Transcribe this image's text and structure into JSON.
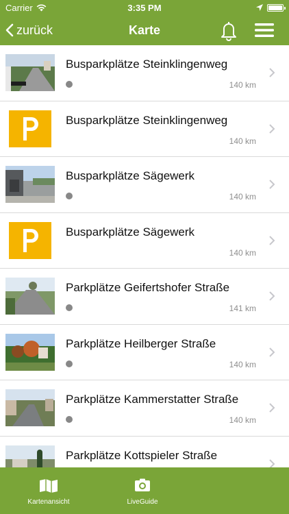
{
  "statusbar": {
    "carrier": "Carrier",
    "time": "3:35 PM"
  },
  "navbar": {
    "back_label": "zurück",
    "title": "Karte"
  },
  "list": {
    "items": [
      {
        "title": "Busparkplätze Steinklingenweg",
        "distance": "140 km",
        "thumb": "photo-road"
      },
      {
        "title": "Busparkplätze Steinklingenweg",
        "distance": "140 km",
        "thumb": "parking-sign"
      },
      {
        "title": "Busparkplätze Sägewerk",
        "distance": "140 km",
        "thumb": "photo-building"
      },
      {
        "title": "Busparkplätze Sägewerk",
        "distance": "140 km",
        "thumb": "parking-sign"
      },
      {
        "title": "Parkplätze Geifertshofer Straße",
        "distance": "141 km",
        "thumb": "photo-road"
      },
      {
        "title": "Parkplätze Heilberger Straße",
        "distance": "140 km",
        "thumb": "photo-autumn"
      },
      {
        "title": "Parkplätze Kammerstatter Straße",
        "distance": "140 km",
        "thumb": "photo-road"
      },
      {
        "title": "Parkplätze Kottspieler Straße",
        "distance": "",
        "thumb": "photo-road"
      }
    ]
  },
  "tabbar": {
    "tab1_label": "Kartenansicht",
    "tab2_label": "LiveGuide"
  },
  "colors": {
    "accent": "#7aa538",
    "parking_sign": "#f5b400"
  }
}
